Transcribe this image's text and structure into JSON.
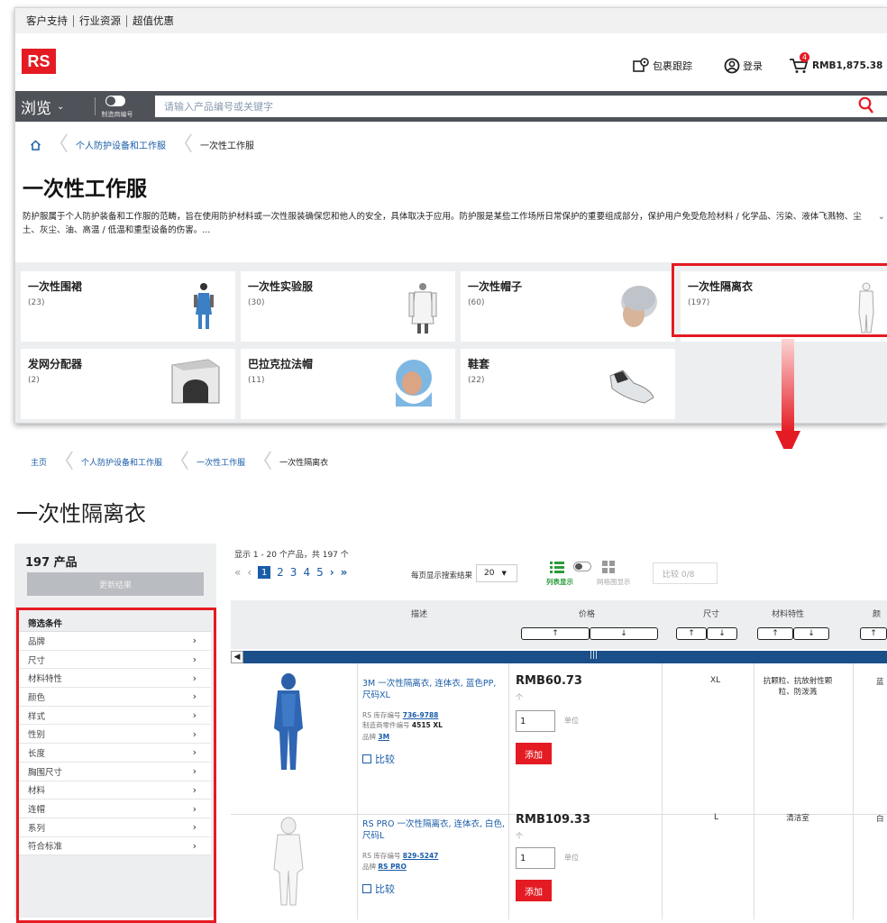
{
  "util_links": [
    "客户支持",
    "行业资源",
    "超值优惠"
  ],
  "logo": "RS",
  "header": {
    "track": "包裹跟踪",
    "login": "登录",
    "cart_count": "4",
    "cart_total": "RMB1,875.38"
  },
  "nav": {
    "browse": "浏览",
    "toggle_label": "制造商编号",
    "search_placeholder": "请输入产品编号或关键字"
  },
  "breadcrumb1": [
    "个人防护设备和工作服",
    "一次性工作服"
  ],
  "page1_title": "一次性工作服",
  "description": "防护服属于个人防护装备和工作服的范畴，旨在使用防护材料或一次性服装确保您和他人的安全，具体取决于应用。防护服是某些工作场所日常保护的重要组成部分，保护用户免受危险材料 / 化学品、污染、液体飞溅物、尘土、灰尘、油、高温 / 低温和重型设备的伤害。...",
  "categories": [
    {
      "name": "一次性围裙",
      "count": "(23)"
    },
    {
      "name": "一次性实验服",
      "count": "(30)"
    },
    {
      "name": "一次性帽子",
      "count": "(60)"
    },
    {
      "name": "一次性隔离衣",
      "count": "(197)"
    },
    {
      "name": "发网分配器",
      "count": "(2)"
    },
    {
      "name": "巴拉克拉法帽",
      "count": "(11)"
    },
    {
      "name": "鞋套",
      "count": "(22)"
    }
  ],
  "breadcrumb2": [
    "主页",
    "个人防护设备和工作服",
    "一次性工作服",
    "一次性隔离衣"
  ],
  "page2_title": "一次性隔离衣",
  "results": {
    "count": "197 产品",
    "update": "更新结果",
    "showing": "显示 1 - 20 个产品，共 197 个",
    "per_page_label": "每页显示搜索结果",
    "per_page": "20",
    "list_view": "列表显示",
    "grid_view": "网格图显示",
    "compare": "比较 0/8"
  },
  "pages": [
    "1",
    "2",
    "3",
    "4",
    "5"
  ],
  "filter_title": "筛选条件",
  "filters": [
    "品牌",
    "尺寸",
    "材料特性",
    "颜色",
    "样式",
    "性别",
    "长度",
    "胸围尺寸",
    "材料",
    "连帽",
    "系列",
    "符合标准"
  ],
  "columns": {
    "desc": "描述",
    "price": "价格",
    "size": "尺寸",
    "material": "材料特性",
    "color": "颜"
  },
  "products": [
    {
      "title": "3M 一次性隔离衣, 连体衣, 蓝色PP, 尺码XL",
      "stock_label": "RS 库存编号",
      "stock_no": "736-9788",
      "mfr_label": "制造商零件编号",
      "mfr_no": "4515 XL",
      "brand_label": "品牌",
      "brand": "3M",
      "compare": "比较",
      "price": "RMB60.73",
      "per": "个",
      "qty": "1",
      "unit": "单位",
      "add": "添加",
      "size": "XL",
      "material": "抗颗粒、抗放射性颗粒、防泼溅",
      "color": "蓝"
    },
    {
      "title": "RS PRO 一次性隔离衣, 连体衣, 白色, 尺码L",
      "stock_label": "RS 库存编号",
      "stock_no": "829-5247",
      "brand_label": "品牌",
      "brand": "RS PRO",
      "compare": "比较",
      "price": "RMB109.33",
      "per": "个",
      "qty": "1",
      "unit": "单位",
      "add": "添加",
      "size": "L",
      "material": "清洁室",
      "color": "白"
    }
  ],
  "colors": {
    "brand_red": "#e41b23",
    "nav_gray": "#4f5258",
    "link_blue": "#1a5ca8"
  }
}
